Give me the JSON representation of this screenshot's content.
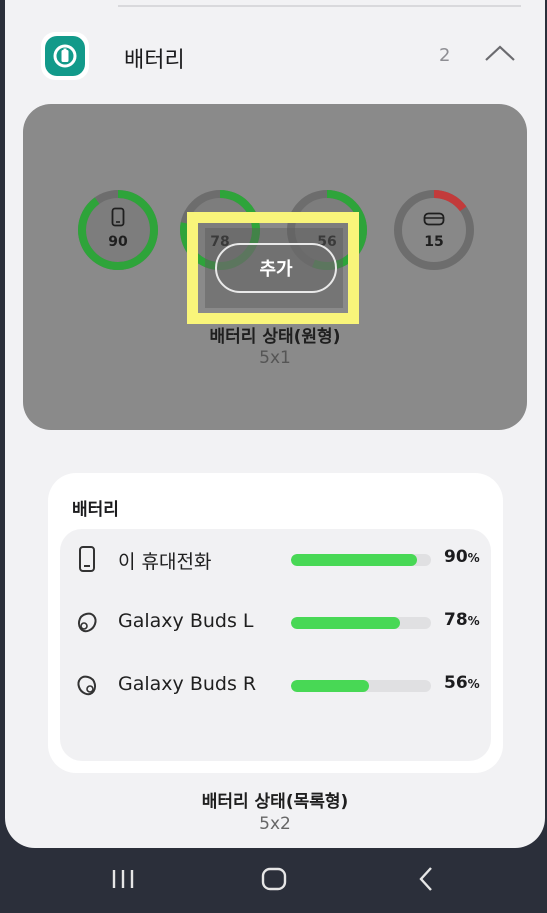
{
  "header": {
    "title": "배터리",
    "count": "2"
  },
  "preview": {
    "rings": [
      {
        "value": "90",
        "fraction": 0.9,
        "color": "#2ea43a",
        "icon": "phone-icon"
      },
      {
        "value": "78",
        "fraction": 0.78,
        "color": "#2ea43a",
        "icon": "earbud-icon"
      },
      {
        "value": "56",
        "fraction": 0.56,
        "color": "#2ea43a",
        "icon": "earbud-icon"
      },
      {
        "value": "15",
        "fraction": 0.15,
        "color": "#c23b3b",
        "icon": "case-icon"
      }
    ],
    "add_label": "추가",
    "title": "배터리 상태(원형)",
    "size": "5x1"
  },
  "list_widget": {
    "title": "배터리",
    "items": [
      {
        "label": "이 휴대전화",
        "percent": "90",
        "unit": "%",
        "fraction": 0.9,
        "icon": "phone-icon"
      },
      {
        "label": "Galaxy Buds L",
        "percent": "78",
        "unit": "%",
        "fraction": 0.78,
        "icon": "earbud-left-icon"
      },
      {
        "label": "Galaxy Buds R",
        "percent": "56",
        "unit": "%",
        "fraction": 0.56,
        "icon": "earbud-right-icon"
      }
    ],
    "caption": "배터리 상태(목록형)",
    "size": "5x2"
  },
  "colors": {
    "accent": "#129a8a",
    "bar": "#48d855",
    "highlight": "#f9f57a"
  }
}
